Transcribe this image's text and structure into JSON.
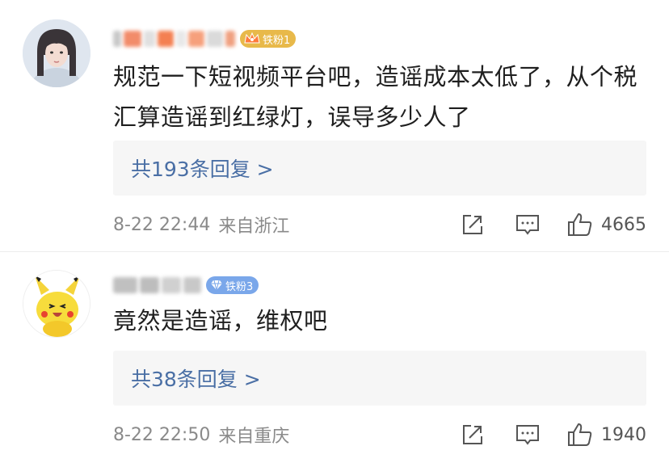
{
  "comments": [
    {
      "badge": "铁粉1",
      "text": "规范一下短视频平台吧，造谣成本太低了，从个税汇算造谣到红绿灯，误导多少人了",
      "replies": "共193条回复 >",
      "time": "8-22 22:44",
      "location": "来自浙江",
      "likes": "4665",
      "badge_color": "#e8b94a"
    },
    {
      "badge": "铁粉3",
      "text": "竟然是造谣，维权吧",
      "replies": "共38条回复 >",
      "time": "8-22 22:50",
      "location": "来自重庆",
      "likes": "1940",
      "badge_color": "#7aa7ea"
    }
  ],
  "icons": {
    "share": "share-icon",
    "comment": "comment-icon",
    "like": "thumbs-up-icon",
    "crown": "crown-icon",
    "diamond": "diamond-icon"
  }
}
